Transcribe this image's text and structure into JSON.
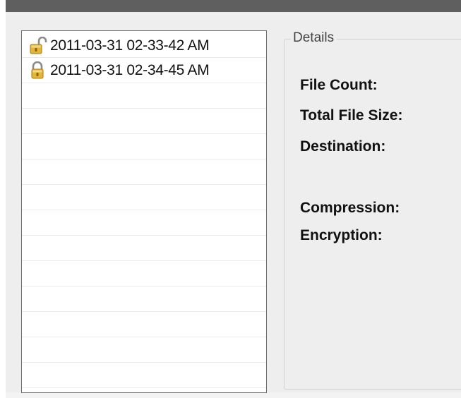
{
  "backups": [
    {
      "label": "2011-03-31 02-33-42 AM",
      "icon": "unlocked-padlock-icon"
    },
    {
      "label": "2011-03-31 02-34-45 AM",
      "icon": "locked-padlock-icon"
    }
  ],
  "details": {
    "title": "Details",
    "file_count_label": "File Count:",
    "total_file_size_label": "Total File Size:",
    "destination_label": "Destination:",
    "compression_label": "Compression:",
    "encryption_label": "Encryption:"
  },
  "colors": {
    "titlebar": "#5f5f5f",
    "window_background": "#eeeeee",
    "padlock_gold": "#e3b53a"
  }
}
